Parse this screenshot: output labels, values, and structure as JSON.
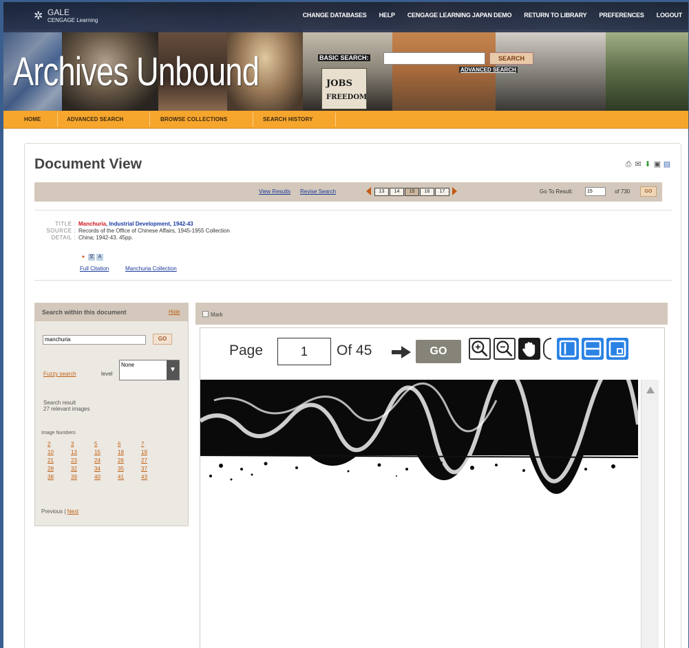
{
  "brand": {
    "logo_main": "GALE",
    "logo_sub": "CENGAGE Learning",
    "site_title": "Archives Unbound"
  },
  "top_nav": [
    "CHANGE DATABASES",
    "HELP",
    "CENGAGE LEARNING JAPAN DEMO",
    "RETURN TO LIBRARY",
    "PREFERENCES",
    "LOGOUT"
  ],
  "basic_search": {
    "label": "BASIC SEARCH:",
    "value": "",
    "button": "SEARCH",
    "advanced_link": "ADVANCED SEARCH"
  },
  "banner_sign": [
    "JOBS",
    "FREEDOM"
  ],
  "main_nav": [
    "HOME",
    "ADVANCED SEARCH",
    "BROWSE COLLECTIONS",
    "SEARCH HISTORY"
  ],
  "page": {
    "title": "Document View",
    "tool_icons": [
      "print-icon",
      "email-icon",
      "download-icon",
      "save-icon",
      "bookmark-icon"
    ]
  },
  "result_bar": {
    "view_results": "View Results",
    "revise_search": "Revise Search",
    "pages": [
      "13",
      "14",
      "15",
      "16",
      "17"
    ],
    "current_page": "15",
    "goto_label": "Go To Result:",
    "goto_value": "15",
    "of_count": "of 730",
    "go": "GO"
  },
  "meta": {
    "title_label": "TITLE :",
    "title_red": "Manchuria",
    "title_blue": ", Industrial Development, 1942-43",
    "source_label": "SOURCE :",
    "source_value": "Records of the Office of Chinese Affairs, 1945-1955 Collection",
    "detail_label": "DETAIL :",
    "detail_value": "China; 1942-43. 45pp.",
    "full_citation": "Full Citation",
    "collection_link": "Manchuria Collection"
  },
  "search_panel": {
    "title": "Search within this document",
    "hide": "Hide",
    "query": "manchuria",
    "go": "GO",
    "fuzzy": "Fuzzy search",
    "level_label": "level",
    "level_value": "None",
    "result_line1": "Search result",
    "result_line2": "27 relevant images",
    "image_numbers_label": "Image Numbers",
    "image_numbers": [
      "2",
      "3",
      "5",
      "6",
      "7",
      "10",
      "13",
      "15",
      "18",
      "19",
      "21",
      "23",
      "24",
      "26",
      "27",
      "28",
      "32",
      "34",
      "35",
      "37",
      "38",
      "39",
      "40",
      "41",
      "43"
    ],
    "prev": "Previous",
    "sep": " | ",
    "next": "Next"
  },
  "viewer": {
    "mark_label": "Mark",
    "page_label": "Page",
    "page_value": "1",
    "of_label": "Of",
    "total_pages": "45",
    "go": "GO"
  },
  "colors": {
    "nav_orange": "#f6a62d",
    "bar_tan": "#d3c8bb",
    "panel_bg": "#ece8e2",
    "link_blue": "#1a3a9a",
    "link_orange": "#c06010",
    "title_red": "#d2141e",
    "viewer_blue": "#2a82e4"
  }
}
